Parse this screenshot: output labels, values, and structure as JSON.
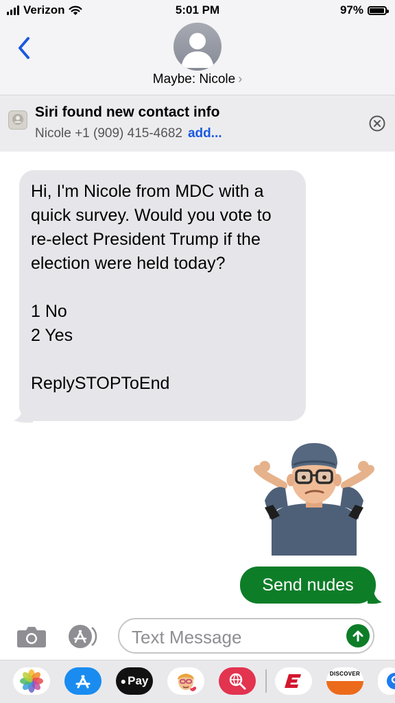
{
  "status_bar": {
    "carrier": "Verizon",
    "time": "5:01 PM",
    "battery": "97%",
    "battery_level": 0.97
  },
  "header": {
    "contact_name": "Maybe: Nicole",
    "chevron": "›",
    "back_icon": "chevron-left-icon"
  },
  "siri_banner": {
    "title": "Siri found new contact info",
    "contact": "Nicole +1 (909) 415-4682",
    "action": "add..."
  },
  "messages": [
    {
      "direction": "incoming",
      "text": "Hi, I'm Nicole from MDC with a quick survey. Would you vote to re-elect President Trump if the election were held today?\n\n1 No\n2 Yes\n\nReplySTOPToEnd"
    },
    {
      "direction": "outgoing",
      "type": "memoji",
      "icon": "shrug-memoji"
    },
    {
      "direction": "outgoing",
      "text": "Send nudes"
    }
  ],
  "composer": {
    "placeholder": "Text Message"
  },
  "app_tray": {
    "items": [
      "photos",
      "app-store",
      "apple-pay",
      "memoji-stickers",
      "web-images",
      "espn",
      "discover",
      "shazam"
    ],
    "apple_pay_label": "Pay",
    "discover_label": "DISCOVER"
  },
  "colors": {
    "accent_blue": "#1a58e0",
    "sent_green": "#0e7d28",
    "received_gray": "#e6e6ea"
  }
}
